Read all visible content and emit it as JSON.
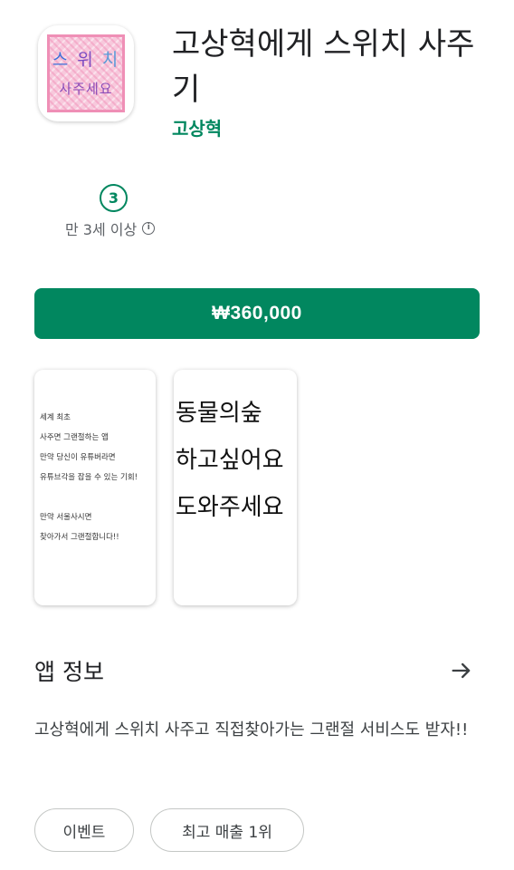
{
  "app": {
    "title": "고상혁에게 스위치 사주기",
    "developer": "고상혁",
    "icon": {
      "line1_chars": [
        "스",
        "위",
        "치"
      ],
      "line2": "사주세요",
      "colors": {
        "background": "#f7c9dc",
        "border": "#ef8fb6"
      }
    }
  },
  "rating": {
    "badge": "3",
    "label": "만 3세 이상",
    "info_icon": "info-icon"
  },
  "buy_button": {
    "label": "₩360,000",
    "color": "#01875f"
  },
  "screenshots": [
    {
      "lines": [
        "세계 최초",
        "사주면 그랜절하는 앱",
        "만약 당신이 유튜버라면",
        "유튜브각을 잡을 수 있는 기회!",
        "",
        "만약 서울사시면",
        "찾아가서 그랜절합니다!!"
      ]
    },
    {
      "lines": [
        "동물의숲",
        "하고싶어요",
        "도와주세요"
      ]
    }
  ],
  "about": {
    "title": "앱 정보",
    "arrow_icon": "arrow-right-icon",
    "description": "고상혁에게 스위치 사주고 직접찾아가는 그랜절 서비스도 받자!!"
  },
  "chips": [
    "이벤트",
    "최고 매출 1위"
  ],
  "accent_color": "#01875f"
}
